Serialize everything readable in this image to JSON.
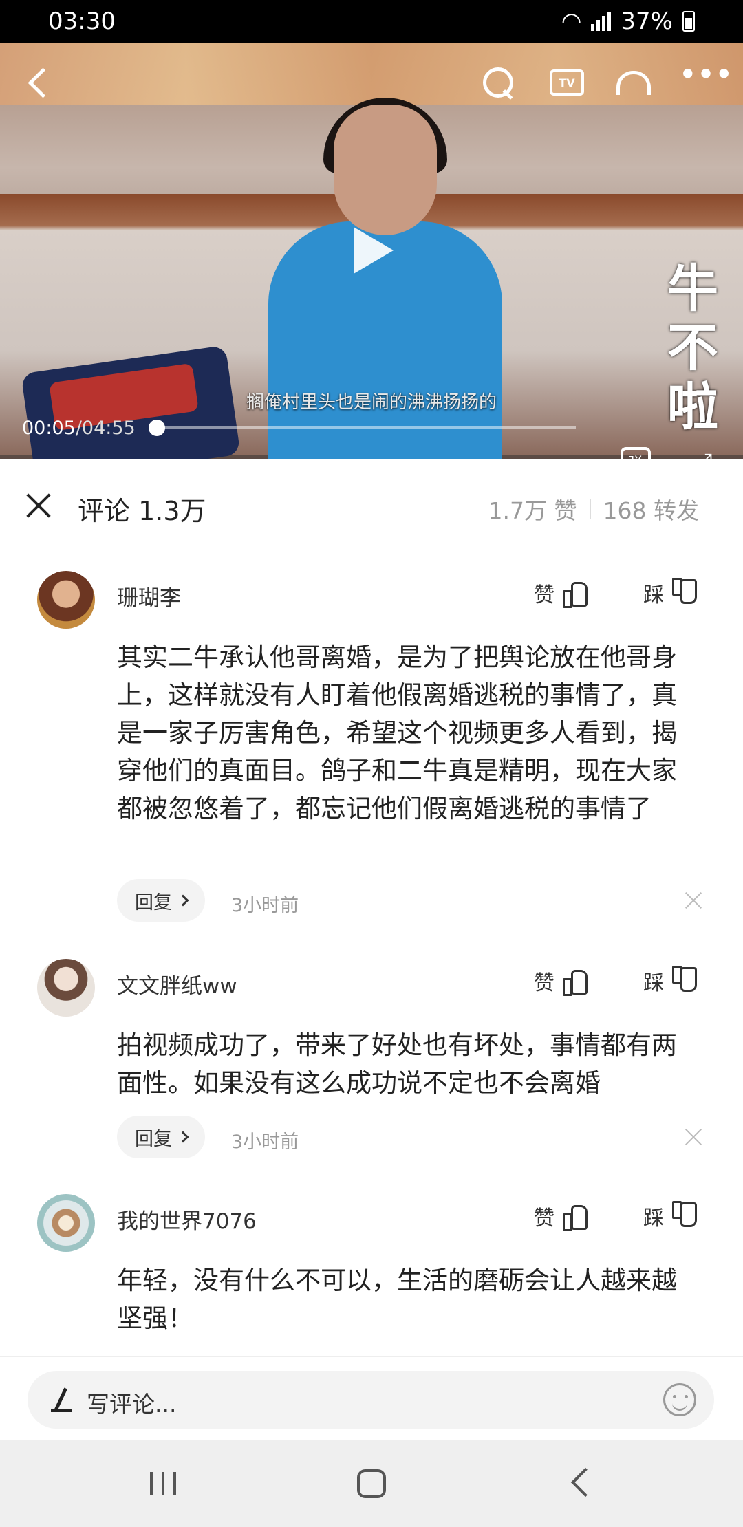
{
  "status_bar": {
    "time": "03:30",
    "battery": "37%"
  },
  "video": {
    "subtitle": "搁俺村里头也是闹的沸沸扬扬的",
    "current_time": "00:05",
    "total_time": "/04:55",
    "progress_fraction": 0.018,
    "watermark": "牛不啦",
    "tv_icon_label": "TV",
    "more_label": "•••",
    "danmu_label": "弹",
    "icons": [
      "back-chevron-icon",
      "search-icon",
      "tv-cast-icon",
      "listen-icon",
      "more-icon",
      "play-icon",
      "danmu-icon",
      "fullscreen-icon"
    ]
  },
  "comments_header": {
    "title": "评论 1.3万",
    "likes": "1.7万 赞",
    "shares": "168 转发"
  },
  "comments": [
    {
      "user": "珊瑚李",
      "like_label": "赞",
      "dislike_label": "踩",
      "text": "其实二牛承认他哥离婚，是为了把舆论放在他哥身上，这样就没有人盯着他假离婚逃税的事情了，真是一家子厉害角色，希望这个视频更多人看到，揭穿他们的真面目。鸽子和二牛真是精明，现在大家都被忽悠着了，都忘记他们假离婚逃税的事情了",
      "reply_label": "回复",
      "time": "3小时前"
    },
    {
      "user": "文文胖纸ww",
      "like_label": "赞",
      "dislike_label": "踩",
      "text": "拍视频成功了，带来了好处也有坏处，事情都有两面性。如果没有这么成功说不定也不会离婚",
      "reply_label": "回复",
      "time": "3小时前"
    },
    {
      "user": "我的世界7076",
      "like_label": "赞",
      "dislike_label": "踩",
      "text": "年轻，没有什么不可以，生活的磨砺会让人越来越坚强！"
    }
  ],
  "input": {
    "placeholder": "写评论..."
  }
}
